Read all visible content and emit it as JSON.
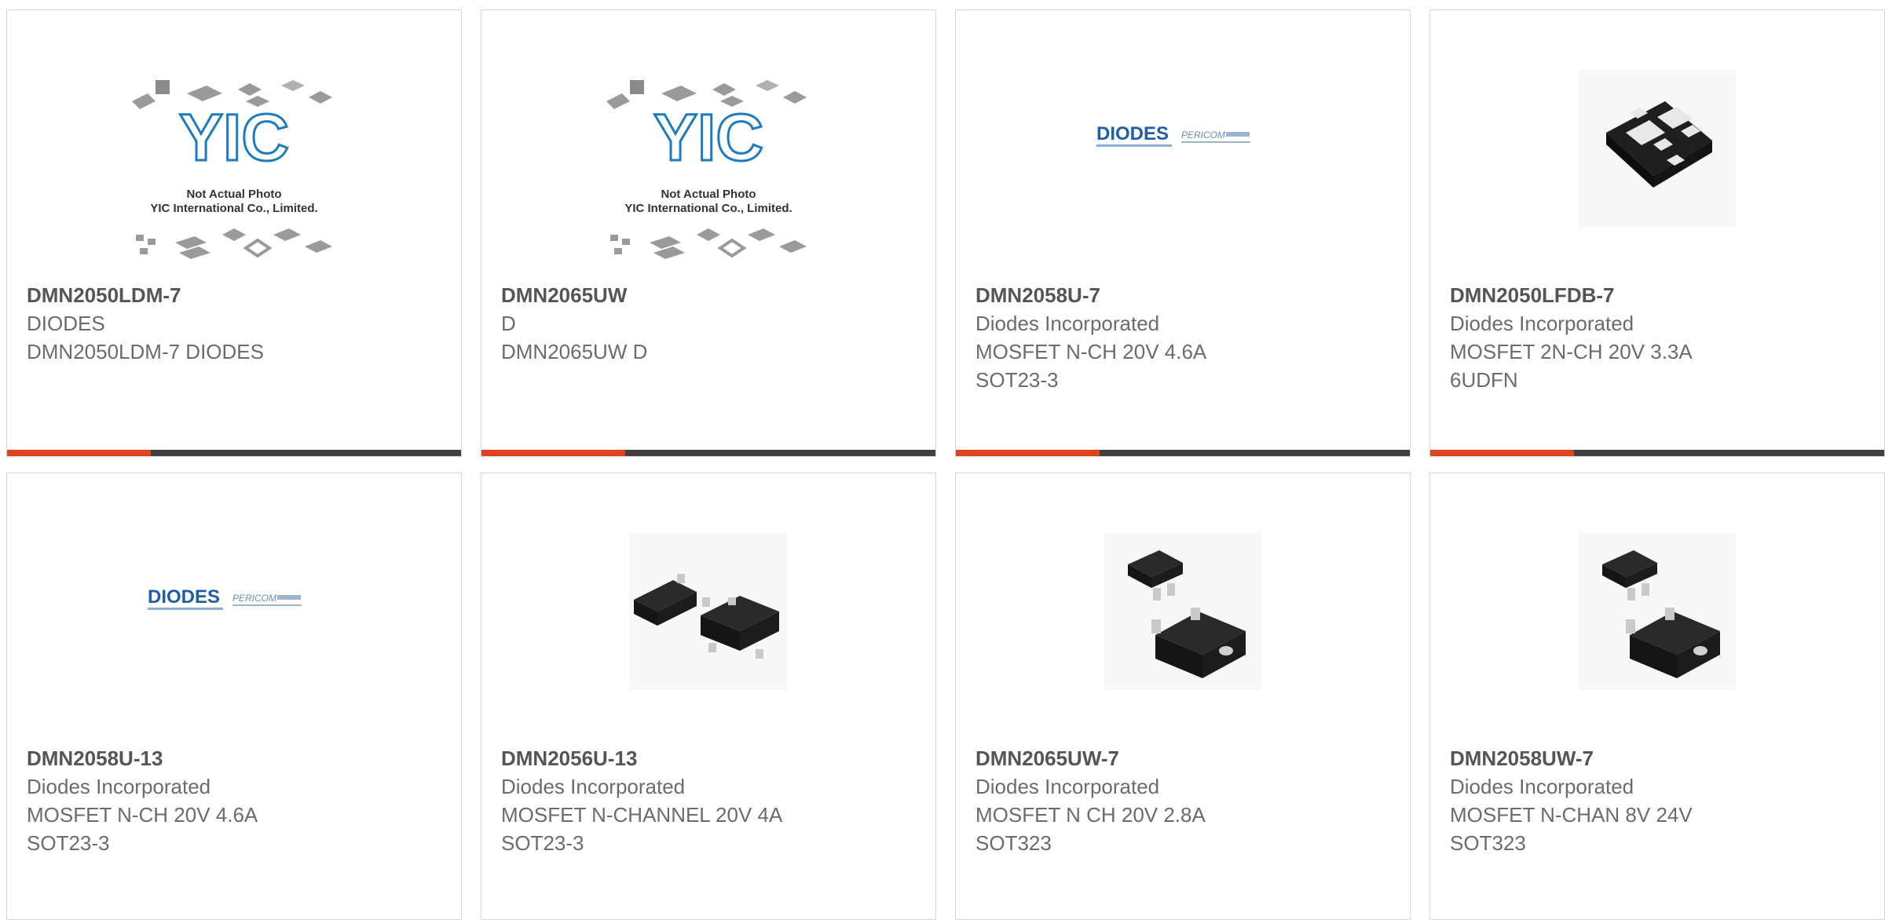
{
  "products": [
    {
      "part": "DMN2050LDM-7",
      "manufacturer": "DIODES",
      "description": "DMN2050LDM-7 DIODES",
      "image": "yic-not-actual-photo",
      "image_caption_1": "Not Actual Photo",
      "image_caption_2": "YIC International Co., Limited.",
      "image_logo": "YIC"
    },
    {
      "part": "DMN2065UW",
      "manufacturer": "D",
      "description": "DMN2065UW D",
      "image": "yic-not-actual-photo",
      "image_caption_1": "Not Actual Photo",
      "image_caption_2": "YIC International Co., Limited.",
      "image_logo": "YIC"
    },
    {
      "part": "DMN2058U-7",
      "manufacturer": "Diodes Incorporated",
      "description": "MOSFET N-CH 20V 4.6A\nSOT23-3",
      "image": "diodes-pericom-logo",
      "image_logo": "DIODES",
      "image_logo_2": "PERICOM"
    },
    {
      "part": "DMN2050LFDB-7",
      "manufacturer": "Diodes Incorporated",
      "description": "MOSFET 2N-CH 20V 3.3A\n6UDFN",
      "image": "udfn-package-photo"
    },
    {
      "part": "DMN2058U-13",
      "manufacturer": "Diodes Incorporated",
      "description": "MOSFET N-CH 20V 4.6A\nSOT23-3",
      "image": "diodes-pericom-logo",
      "image_logo": "DIODES",
      "image_logo_2": "PERICOM"
    },
    {
      "part": "DMN2056U-13",
      "manufacturer": "Diodes Incorporated",
      "description": "MOSFET N-CHANNEL 20V 4A\nSOT23-3",
      "image": "sot23-package-photo"
    },
    {
      "part": "DMN2065UW-7",
      "manufacturer": "Diodes Incorporated",
      "description": "MOSFET N CH 20V 2.8A\nSOT323",
      "image": "sot323-package-photo"
    },
    {
      "part": "DMN2058UW-7",
      "manufacturer": "Diodes Incorporated",
      "description": "MOSFET N-CHAN 8V 24V\nSOT323",
      "image": "sot323-package-photo"
    }
  ],
  "colors": {
    "accent": "#e0421d",
    "bar": "#3f3f3f",
    "border": "#d5d5d5",
    "part_text": "#555555",
    "body_text": "#6b6b6b",
    "diodes_blue": "#1e5fa8"
  }
}
